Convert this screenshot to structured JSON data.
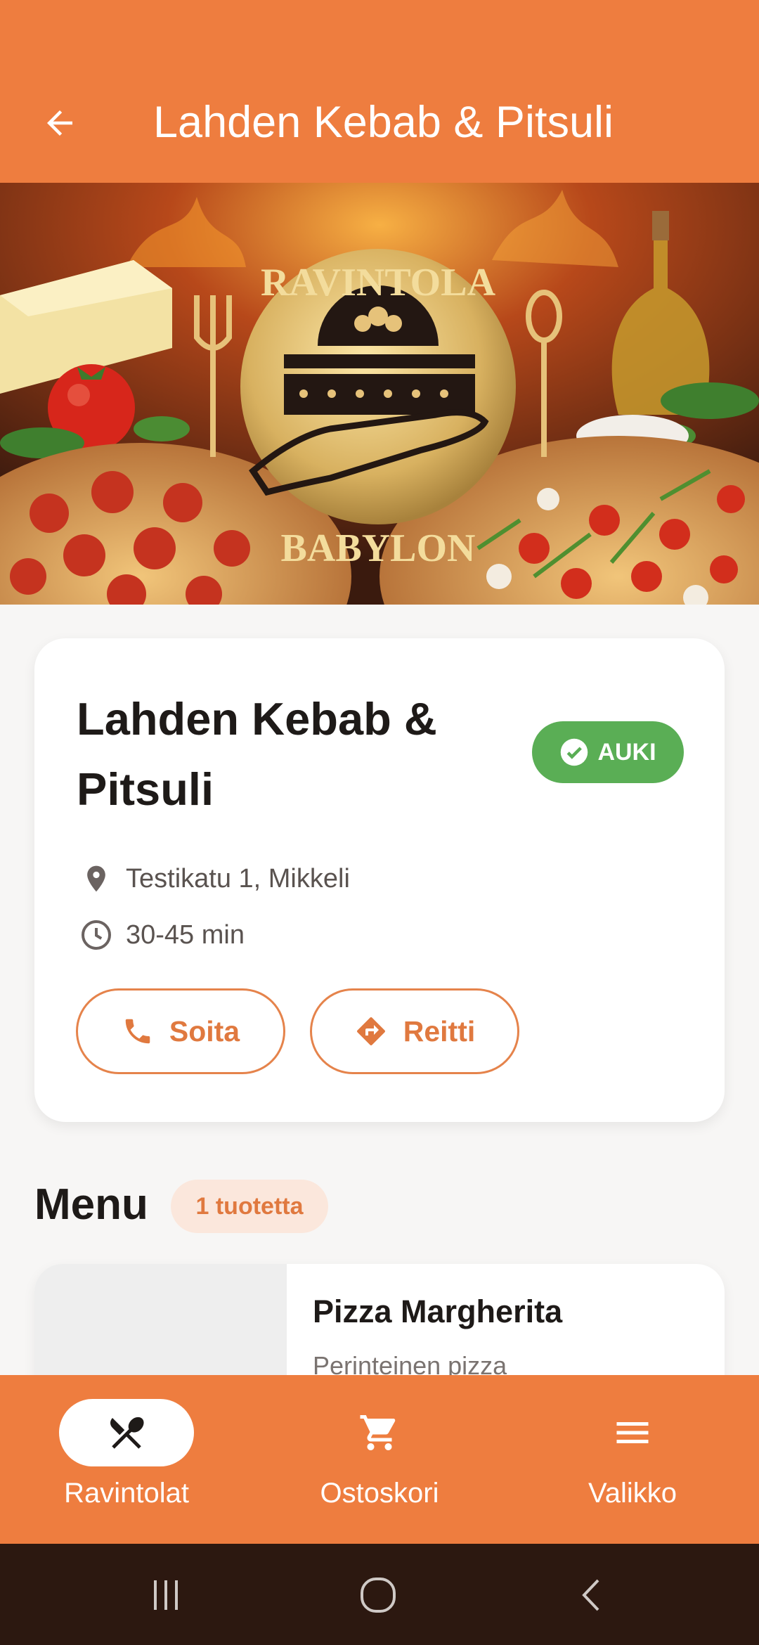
{
  "header": {
    "title": "Lahden Kebab & Pitsuli"
  },
  "hero": {
    "logo_top_text": "RAVINTOLA",
    "logo_bottom_text": "BABYLON"
  },
  "restaurant": {
    "name": "Lahden Kebab & Pitsuli",
    "status": "AUKI",
    "status_color": "#5aae55",
    "address": "Testikatu 1, Mikkeli",
    "delivery_time": "30-45 min",
    "call_label": "Soita",
    "route_label": "Reitti"
  },
  "menu": {
    "heading": "Menu",
    "count": "1 tuotetta",
    "items": [
      {
        "name": "Pizza Margherita",
        "description": "Perinteinen pizza"
      }
    ]
  },
  "bottom_nav": {
    "items": [
      {
        "label": "Ravintolat",
        "icon": "restaurant-icon",
        "active": true
      },
      {
        "label": "Ostoskori",
        "icon": "cart-icon",
        "active": false
      },
      {
        "label": "Valikko",
        "icon": "menu-icon",
        "active": false
      }
    ]
  },
  "colors": {
    "accent": "#ee7d3f",
    "open": "#5aae55",
    "system_bar": "#2c1810"
  }
}
